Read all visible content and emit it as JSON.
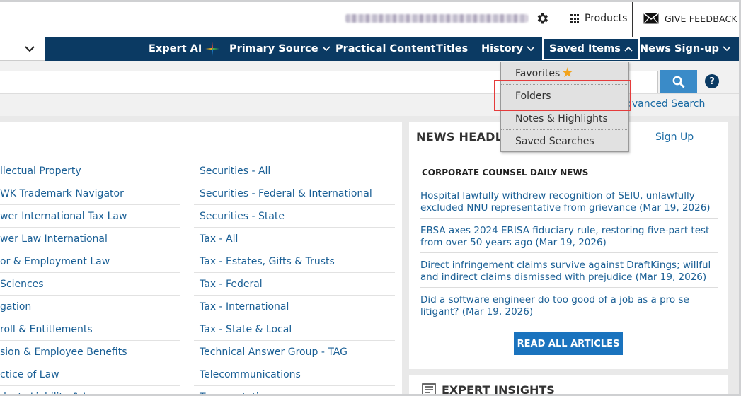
{
  "topbar": {
    "products_label": "Products",
    "feedback_label": "GIVE FEEDBACK"
  },
  "nav": {
    "items": [
      {
        "label": "Expert AI"
      },
      {
        "label": "Primary Source"
      },
      {
        "label": "Practical Content"
      },
      {
        "label": "Titles"
      },
      {
        "label": "History"
      },
      {
        "label": "Saved Items"
      },
      {
        "label": "News Sign-up"
      }
    ]
  },
  "saved_items_menu": {
    "items": [
      "Favorites",
      "Folders",
      "Notes & Highlights",
      "Saved Searches"
    ],
    "highlighted": "Folders"
  },
  "search": {
    "placeholder": "",
    "advanced_label": "dvanced Search"
  },
  "practice_areas": {
    "col1": [
      "llectual Property",
      "WK Trademark Navigator",
      "wer International Tax Law",
      "wer Law International",
      "or & Employment Law",
      " Sciences",
      "gation",
      "roll & Entitlements",
      "sion & Employee Benefits",
      "ctice of Law",
      "ducts Liability & Insurance"
    ],
    "col2": [
      "Securities - All",
      "Securities - Federal & International",
      "Securities - State",
      "Tax - All",
      "Tax - Estates, Gifts & Trusts",
      "Tax - Federal",
      "Tax - International",
      "Tax - State & Local",
      "Technical Answer Group - TAG",
      "Telecommunications",
      "Transportation"
    ]
  },
  "news": {
    "title": "NEWS HEADLINES",
    "signup_label": "Sign Up",
    "subtitle": "CORPORATE COUNSEL DAILY NEWS",
    "articles": [
      "Hospital lawfully withdrew recognition of SEIU, unlawfully excluded NNU representative from grievance (Mar 19, 2026)",
      "EBSA axes 2024 ERISA fiduciary rule, restoring five-part test from over 50 years ago (Mar 19, 2026)",
      "Direct infringement claims survive against DraftKings; willful and indirect claims dismissed with prejudice (Mar 19, 2026)",
      "Did a software engineer do too good of a job as a pro se litigant? (Mar 19, 2026)"
    ],
    "read_all_label": "READ ALL ARTICLES"
  },
  "insights": {
    "title": "EXPERT INSIGHTS"
  },
  "colors": {
    "navy": "#0b3a63",
    "link": "#1a5f95",
    "button_blue": "#1a73be",
    "highlight_red": "#e53b3b",
    "star": "#f2a31b"
  }
}
